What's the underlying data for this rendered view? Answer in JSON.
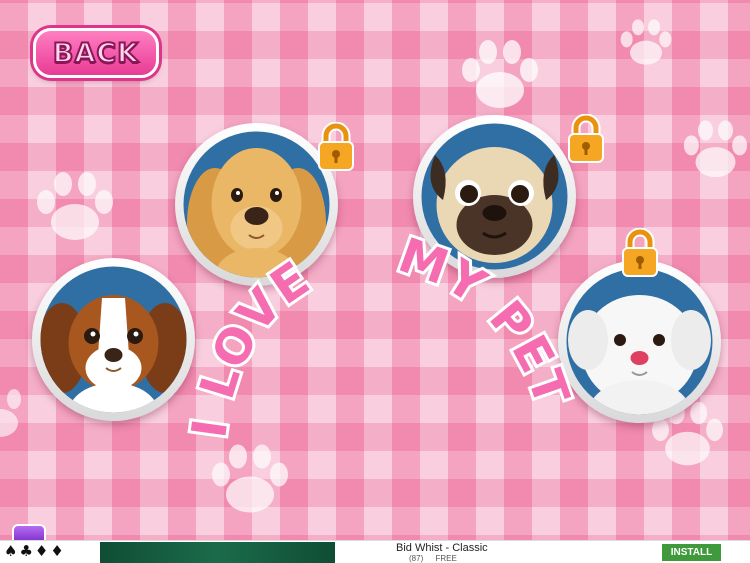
{
  "header": {
    "back_label": "BACK"
  },
  "title": {
    "line1": "I LOVE",
    "line2": "MY PET"
  },
  "pets": [
    {
      "id": "cocker-spaniel",
      "locked": true
    },
    {
      "id": "pug",
      "locked": true
    },
    {
      "id": "cavalier",
      "locked": false
    },
    {
      "id": "maltese",
      "locked": true
    }
  ],
  "ad": {
    "title": "Bid Whist - Classic",
    "rating_count": "(87)",
    "price": "FREE",
    "install_label": "INSTALL",
    "suits": "♠♣♦♦"
  },
  "colors": {
    "accent": "#e83b96",
    "lock": "#f39c12",
    "title": "#f25aa6"
  }
}
